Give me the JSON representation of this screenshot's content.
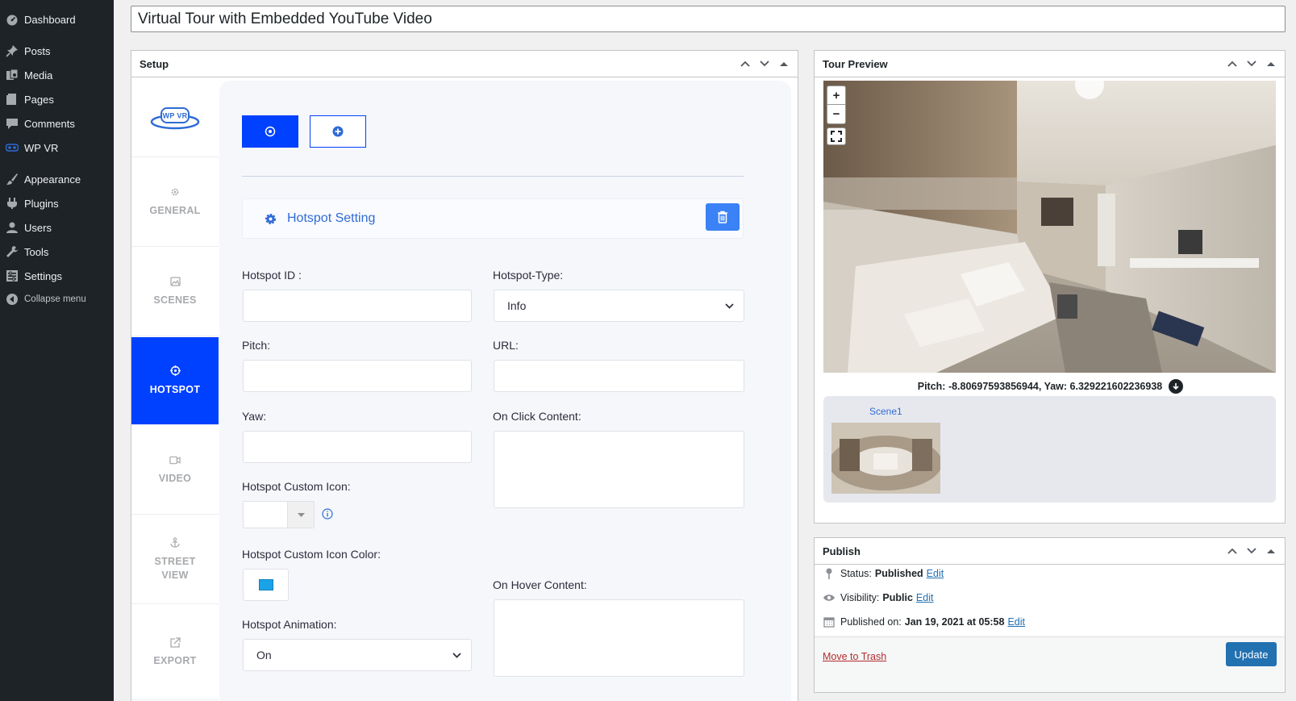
{
  "admin_menu": {
    "items": [
      {
        "label": "Dashboard",
        "icon": "dashboard-icon"
      },
      {
        "label": "Posts",
        "icon": "pin-icon"
      },
      {
        "label": "Media",
        "icon": "media-icon"
      },
      {
        "label": "Pages",
        "icon": "pages-icon"
      },
      {
        "label": "Comments",
        "icon": "comment-icon"
      },
      {
        "label": "WP VR",
        "icon": "vr-icon"
      },
      {
        "label": "Appearance",
        "icon": "brush-icon"
      },
      {
        "label": "Plugins",
        "icon": "plugin-icon"
      },
      {
        "label": "Users",
        "icon": "user-icon"
      },
      {
        "label": "Tools",
        "icon": "wrench-icon"
      },
      {
        "label": "Settings",
        "icon": "settings-icon"
      },
      {
        "label": "Collapse menu",
        "icon": "collapse-icon"
      }
    ]
  },
  "title": {
    "value": "Virtual Tour with Embedded YouTube Video"
  },
  "setup": {
    "title": "Setup",
    "logo_text": "WP VR",
    "tabs": [
      {
        "label": "GENERAL",
        "icon": "gear-icon"
      },
      {
        "label": "SCENES",
        "icon": "image-icon"
      },
      {
        "label": "HOTSPOT",
        "icon": "crosshair-icon",
        "active": true
      },
      {
        "label": "VIDEO",
        "icon": "video-icon"
      },
      {
        "label": "STREET VIEW",
        "icon": "anchor-icon"
      },
      {
        "label": "EXPORT",
        "icon": "external-link-icon"
      }
    ],
    "hotspot_setting_label": "Hotspot Setting",
    "fields": {
      "hotspot_id_label": "Hotspot ID :",
      "hotspot_type_label": "Hotspot-Type:",
      "hotspot_type_value": "Info",
      "pitch_label": "Pitch:",
      "url_label": "URL:",
      "yaw_label": "Yaw:",
      "on_click_label": "On Click Content:",
      "custom_icon_label": "Hotspot Custom Icon:",
      "custom_icon_color_label": "Hotspot Custom Icon Color:",
      "on_hover_label": "On Hover Content:",
      "animation_label": "Hotspot Animation:",
      "animation_value": "On"
    },
    "colors": {
      "accent": "#0040ff",
      "icon_color_swatch": "#1aa3e8",
      "arrow": "#f5a623"
    }
  },
  "tour_preview": {
    "title": "Tour Preview",
    "zoom_in": "+",
    "zoom_out": "−",
    "coords_text": "Pitch: -8.80697593856944, Yaw: 6.329221602236938",
    "scene_label": "Scene1"
  },
  "publish": {
    "title": "Publish",
    "status_label": "Status:",
    "status_value": "Published",
    "visibility_label": "Visibility:",
    "visibility_value": "Public",
    "published_label": "Published on:",
    "published_value": "Jan 19, 2021 at 05:58",
    "edit_label": "Edit",
    "trash_label": "Move to Trash",
    "update_label": "Update"
  }
}
